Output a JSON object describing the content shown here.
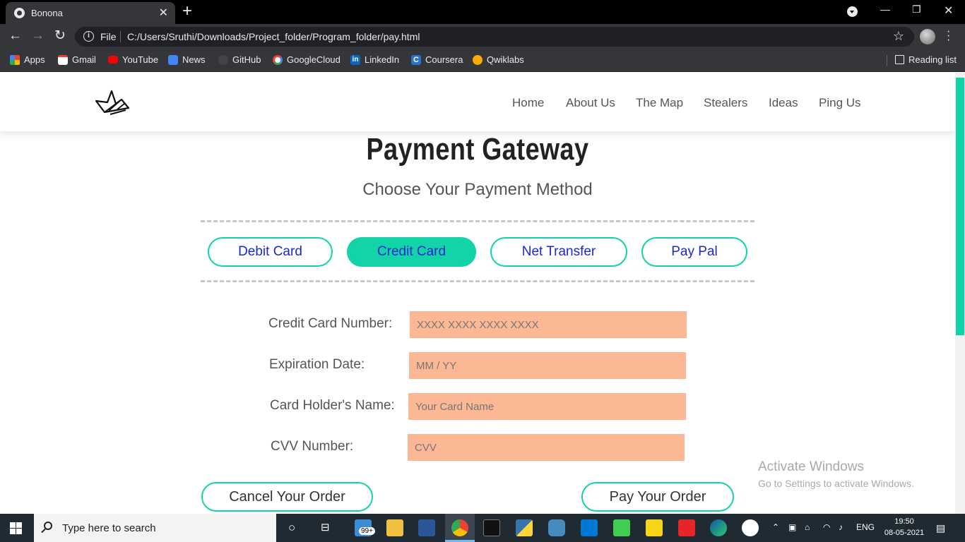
{
  "browser": {
    "tab_title": "Bonona",
    "address": {
      "scheme_label": "File",
      "url": "C:/Users/Sruthi/Downloads/Project_folder/Program_folder/pay.html"
    },
    "bookmarks": [
      {
        "label": "Apps",
        "icon": "apps-grid-icon",
        "color": "#f28b82"
      },
      {
        "label": "Gmail",
        "icon": "gmail-icon",
        "color": "#ea4335"
      },
      {
        "label": "YouTube",
        "icon": "youtube-icon",
        "color": "#ff0000"
      },
      {
        "label": "News",
        "icon": "google-news-icon",
        "color": "#4285f4"
      },
      {
        "label": "GitHub",
        "icon": "github-icon",
        "color": "#444444"
      },
      {
        "label": "GoogleCloud",
        "icon": "google-icon",
        "color": "#ffffff"
      },
      {
        "label": "LinkedIn",
        "icon": "linkedin-icon",
        "color": "#0a66c2"
      },
      {
        "label": "Coursera",
        "icon": "coursera-icon",
        "color": "#2a73cc"
      },
      {
        "label": "Qwiklabs",
        "icon": "qwiklabs-icon",
        "color": "#f9ab00"
      }
    ],
    "reading_list": "Reading list"
  },
  "site": {
    "nav": [
      "Home",
      "About Us",
      "The Map",
      "Stealers",
      "Ideas",
      "Ping Us"
    ],
    "title": "Payment Gateway",
    "subtitle": "Choose Your Payment Method",
    "methods": [
      {
        "label": "Debit Card",
        "active": false
      },
      {
        "label": "Credit Card",
        "active": true
      },
      {
        "label": "Net Transfer",
        "active": false
      },
      {
        "label": "Pay Pal",
        "active": false
      }
    ],
    "form": {
      "card_number": {
        "label": "Credit Card Number:",
        "placeholder": "XXXX XXXX XXXX XXXX"
      },
      "expiry": {
        "label": "Expiration Date:",
        "placeholder": "MM / YY"
      },
      "holder": {
        "label": "Card Holder's Name:",
        "placeholder": "Your Card Name"
      },
      "cvv": {
        "label": "CVV Number:",
        "placeholder": "CVV"
      }
    },
    "cancel_label": "Cancel Your Order",
    "pay_label": "Pay Your Order",
    "accent_color": "#13d3a8",
    "field_color": "#fcb794"
  },
  "watermark": {
    "line1": "Activate Windows",
    "line2": "Go to Settings to activate Windows."
  },
  "taskbar": {
    "search_placeholder": "Type here to search",
    "mail_badge": "99+",
    "language": "ENG",
    "time": "19:50",
    "date": "08-05-2021"
  }
}
